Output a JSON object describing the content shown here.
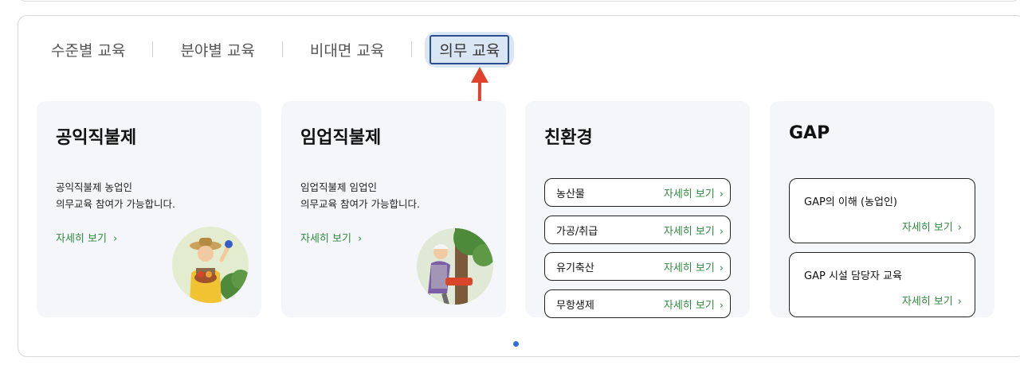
{
  "tabs": {
    "level": "수준별 교육",
    "field": "분야별 교육",
    "online": "비대면 교육",
    "mandatory": "의무 교육"
  },
  "cards": {
    "public": {
      "title": "공익직불제",
      "desc_line1": "공익직불제 농업인",
      "desc_line2": "의무교육 참여가 가능합니다.",
      "more": "자세히 보기"
    },
    "forestry": {
      "title": "임업직불제",
      "desc_line1": "임업직불제 임업인",
      "desc_line2": "의무교육 참여가 가능합니다.",
      "more": "자세히 보기"
    },
    "eco": {
      "title": "친환경",
      "items": [
        {
          "label": "농산물",
          "more": "자세히 보기"
        },
        {
          "label": "가공/취급",
          "more": "자세히 보기"
        },
        {
          "label": "유기축산",
          "more": "자세히 보기"
        },
        {
          "label": "무항생제",
          "more": "자세히 보기"
        }
      ]
    },
    "gap": {
      "title": "GAP",
      "items": [
        {
          "label": "GAP의 이해 (농업인)",
          "more": "자세히 보기"
        },
        {
          "label": "GAP 시설 담당자 교육",
          "more": "자세히 보기"
        }
      ]
    }
  },
  "icons": {
    "chevron": "chevron-right-icon",
    "arrow": "red-arrow-up-icon"
  },
  "colors": {
    "accent_green": "#2f8a3e",
    "active_tab_border": "#2a4f8f",
    "active_tab_bg": "#dbe6f5",
    "arrow_red": "#e0432b",
    "pagination_dot": "#2f6fd6"
  },
  "pagination": {
    "current": 1
  }
}
